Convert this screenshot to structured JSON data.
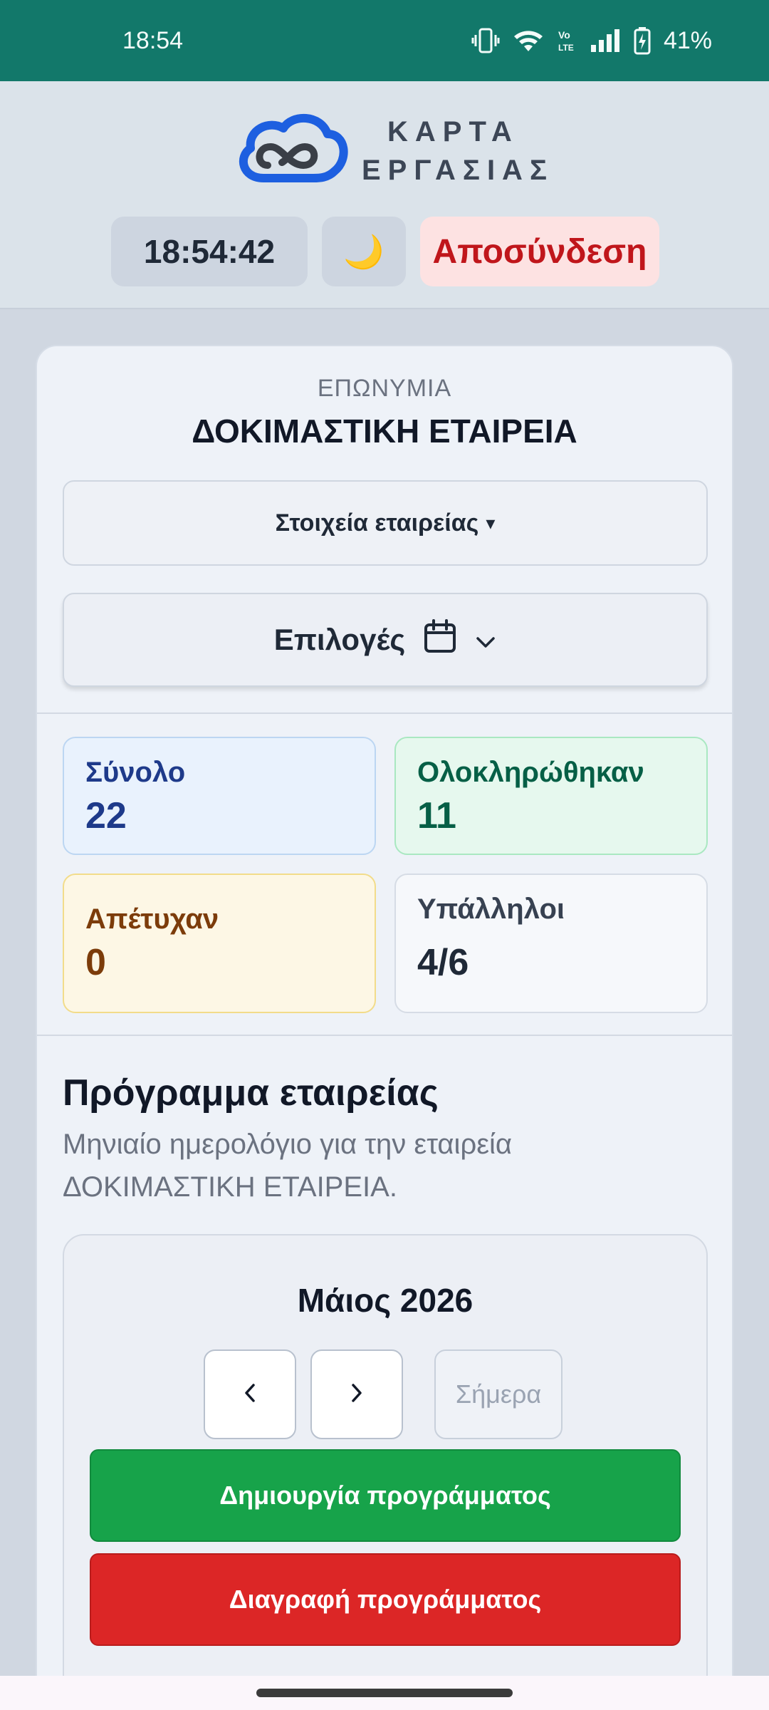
{
  "status_bar": {
    "time": "18:54",
    "battery": "41%"
  },
  "header": {
    "logo_line1": "ΚΑΡΤΑ",
    "logo_line2": "ΕΡΓΑΣΙΑΣ",
    "clock": "18:54:42",
    "theme_icon": "🌙",
    "logout_label": "Αποσύνδεση"
  },
  "company": {
    "label": "ΕΠΩΝΥΜΙΑ",
    "name": "ΔΟΚΙΜΑΣΤΙΚΗ ΕΤΑΙΡΕΙΑ",
    "details_label": "Στοιχεία εταιρείας",
    "details_caret": "▾",
    "options_label": "Επιλογές"
  },
  "stats": [
    {
      "label": "Σύνολο",
      "value": "22"
    },
    {
      "label": "Ολοκληρώθηκαν",
      "value": "11"
    },
    {
      "label": "Απέτυχαν",
      "value": "0"
    },
    {
      "label": "Υπάλληλοι",
      "value": "4/6"
    }
  ],
  "schedule": {
    "title": "Πρόγραμμα εταιρείας",
    "description": "Μηνιαίο ημερολόγιο για την εταιρεία ΔΟΚΙΜΑΣΤΙΚΗ ΕΤΑΙΡΕΙΑ.",
    "month": "Μάιος 2026",
    "today_label": "Σήμερα",
    "create_label": "Δημιουργία προγράμματος",
    "delete_label": "Διαγραφή προγράμματος"
  },
  "colors": {
    "status_bar": "#12786a",
    "create": "#17a34a",
    "delete": "#dc2626",
    "logout_text": "#c0161b"
  }
}
